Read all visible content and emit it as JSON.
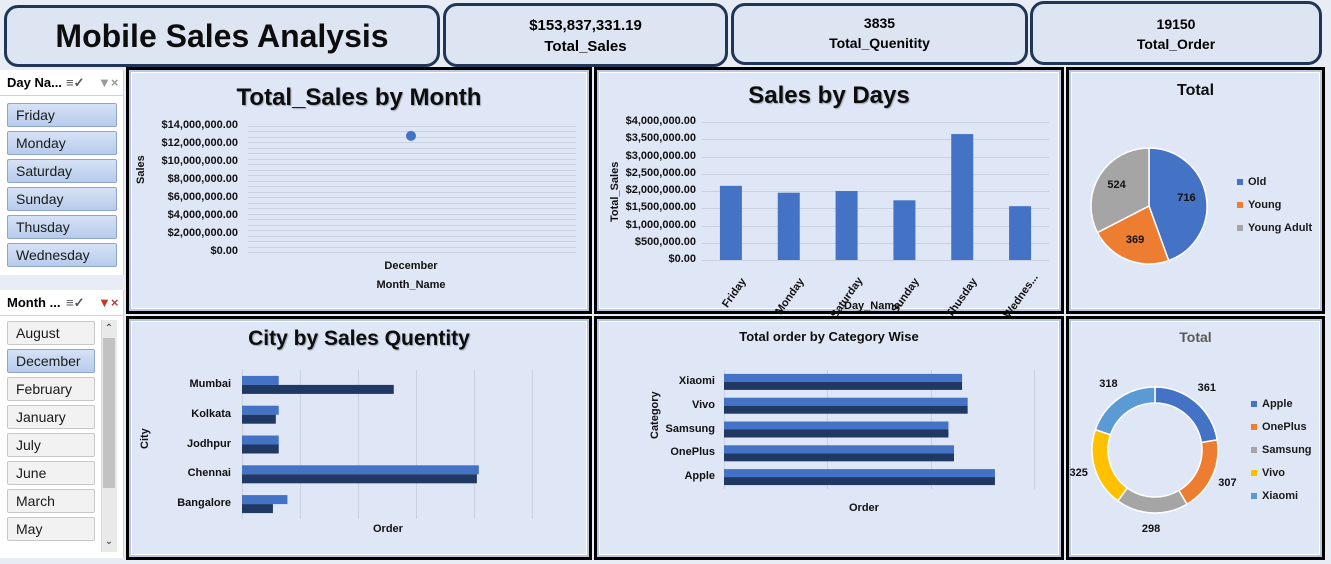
{
  "header": {
    "title": "Mobile Sales Analysis",
    "kpis": [
      {
        "value": "$153,837,331.19",
        "label": "Total_Sales"
      },
      {
        "value": "3835",
        "label": "Total_Quenitity"
      },
      {
        "value": "19150",
        "label": "Total_Order"
      }
    ]
  },
  "slicers": {
    "day": {
      "title": "Day Na...",
      "items": [
        {
          "label": "Friday",
          "selected": true
        },
        {
          "label": "Monday",
          "selected": true
        },
        {
          "label": "Saturday",
          "selected": true
        },
        {
          "label": "Sunday",
          "selected": true
        },
        {
          "label": "Thusday",
          "selected": true
        },
        {
          "label": "Wednesday",
          "selected": true
        }
      ]
    },
    "month": {
      "title": "Month ...",
      "items": [
        {
          "label": "August",
          "selected": false
        },
        {
          "label": "December",
          "selected": true
        },
        {
          "label": "February",
          "selected": false
        },
        {
          "label": "January",
          "selected": false
        },
        {
          "label": "July",
          "selected": false
        },
        {
          "label": "June",
          "selected": false
        },
        {
          "label": "March",
          "selected": false
        },
        {
          "label": "May",
          "selected": false
        }
      ]
    }
  },
  "colors": {
    "blue": "#4472c4",
    "navy": "#1f3864",
    "orange": "#ed7d31",
    "gray": "#a5a5a5",
    "yellow": "#ffc000",
    "lightblue": "#5b9bd5"
  },
  "chart_data": [
    {
      "id": "sales_by_month",
      "type": "scatter",
      "title": "Total_Sales by Month",
      "xlabel": "Month_Name",
      "ylabel": "Sales",
      "categories": [
        "December"
      ],
      "values": [
        12900000
      ],
      "ylim": [
        0,
        14000000
      ],
      "yticks": [
        "$14,000,000.00",
        "$12,000,000.00",
        "$10,000,000.00",
        "$8,000,000.00",
        "$6,000,000.00",
        "$4,000,000.00",
        "$2,000,000.00",
        "$0.00"
      ],
      "grid": true
    },
    {
      "id": "sales_by_days",
      "type": "bar",
      "title": "Sales by Days",
      "xlabel": "Day_Name",
      "ylabel": "Total_Sales",
      "categories": [
        "Friday",
        "Monday",
        "Saturday",
        "Sunday",
        "Thusday",
        "Wednes..."
      ],
      "values": [
        2150000,
        1950000,
        2000000,
        1730000,
        3650000,
        1560000
      ],
      "ylim": [
        0,
        4000000
      ],
      "yticks": [
        "$4,000,000.00",
        "$3,500,000.00",
        "$3,000,000.00",
        "$2,500,000.00",
        "$2,000,000.00",
        "$1,500,000.00",
        "$1,000,000.00",
        "$500,000.00",
        "$0.00"
      ],
      "grid": true
    },
    {
      "id": "total_by_age",
      "type": "pie",
      "title": "Total",
      "categories": [
        "Old",
        "Young",
        "Young Adult"
      ],
      "values": [
        716,
        369,
        524
      ],
      "value_labels": [
        "716",
        "369",
        "524"
      ],
      "legend": "right"
    },
    {
      "id": "city_by_quantity",
      "type": "bar",
      "orientation": "horizontal",
      "title": "City by Sales Quentity",
      "xlabel": "Order",
      "ylabel": "City",
      "categories": [
        "Mumbai",
        "Kolkata",
        "Jodhpur",
        "Chennai",
        "Bangalore"
      ],
      "series": [
        {
          "values": [
            38,
            38,
            38,
            245,
            47
          ]
        },
        {
          "values": [
            157,
            35,
            38,
            243,
            32
          ]
        }
      ],
      "xlim": [
        0,
        300
      ],
      "grid": true
    },
    {
      "id": "order_by_category",
      "type": "bar",
      "orientation": "horizontal",
      "title": "Total order by Category Wise",
      "xlabel": "Order",
      "ylabel": "Category",
      "categories": [
        "Xiaomi",
        "Vivo",
        "Samsung",
        "OnePlus",
        "Apple"
      ],
      "series": [
        {
          "values": [
            3840,
            3930,
            3620,
            3710,
            4370
          ]
        },
        {
          "values": [
            3840,
            3930,
            3620,
            3710,
            4370
          ]
        }
      ],
      "xlim": [
        0,
        5000
      ],
      "grid": true
    },
    {
      "id": "total_by_brand",
      "type": "pie",
      "donut": true,
      "title": "Total",
      "categories": [
        "Apple",
        "OnePlus",
        "Samsung",
        "Vivo",
        "Xiaomi"
      ],
      "values": [
        361,
        307,
        298,
        325,
        318
      ],
      "value_labels": [
        "361",
        "307",
        "298",
        "325",
        "318"
      ],
      "legend": "right"
    }
  ]
}
